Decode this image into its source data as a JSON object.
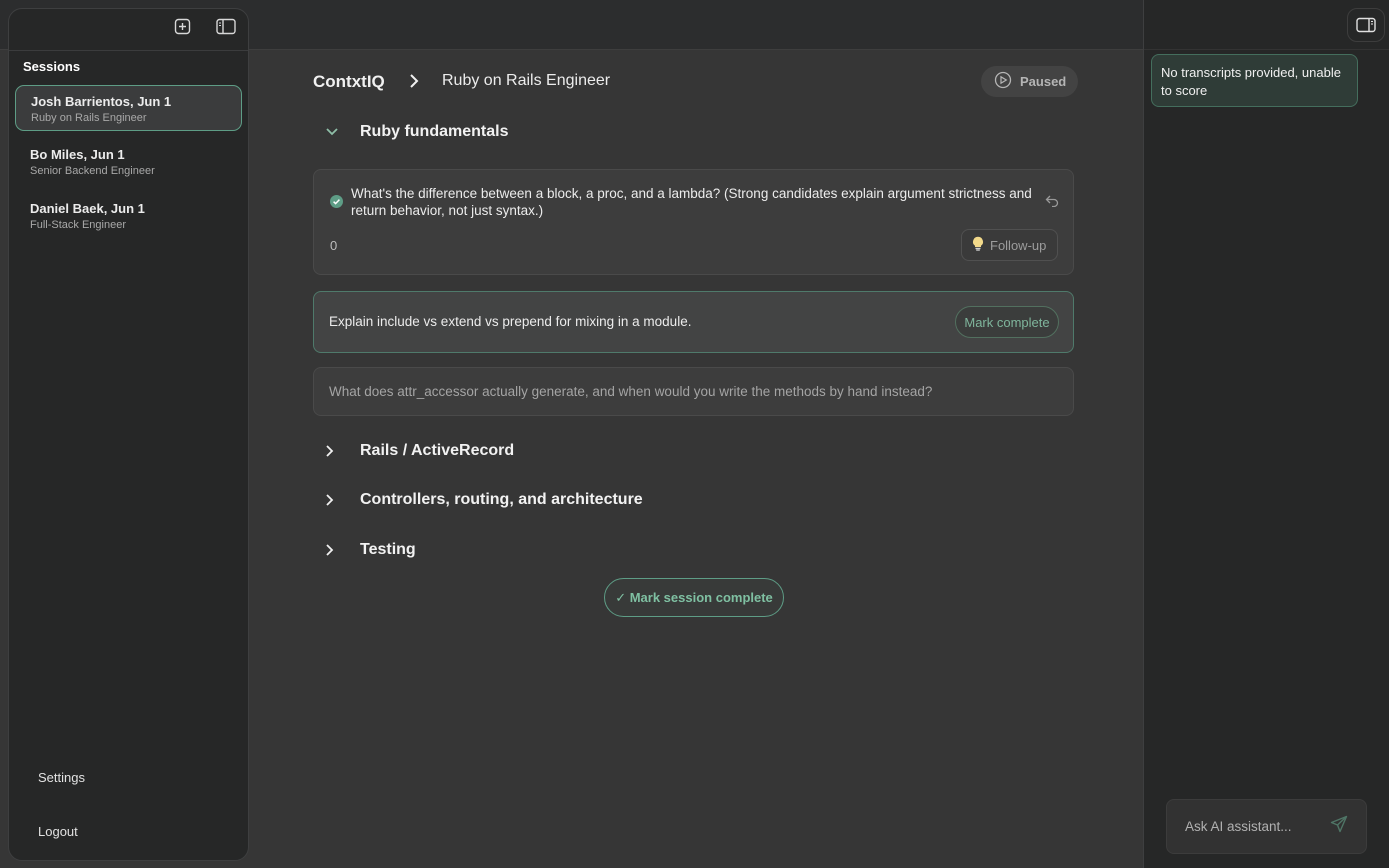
{
  "sidebar": {
    "title": "Sessions",
    "sessions": [
      {
        "name": "Josh Barrientos, Jun 1",
        "role": "Ruby on Rails Engineer",
        "active": true
      },
      {
        "name": "Bo Miles, Jun 1",
        "role": "Senior Backend Engineer",
        "active": false
      },
      {
        "name": "Daniel Baek, Jun 1",
        "role": "Full-Stack Engineer",
        "active": false
      }
    ],
    "settings_label": "Settings",
    "logout_label": "Logout"
  },
  "header": {
    "brand": "ContxtIQ",
    "page_title": "Ruby on Rails Engineer",
    "status_label": "Paused"
  },
  "sections": [
    {
      "label": "Ruby fundamentals",
      "expanded": true
    },
    {
      "label": "Rails / ActiveRecord",
      "expanded": false
    },
    {
      "label": "Controllers, routing, and architecture",
      "expanded": false
    },
    {
      "label": "Testing",
      "expanded": false
    }
  ],
  "questions": [
    {
      "text": "What's the difference between a block, a proc, and a lambda? (Strong candidates explain argument strictness and return behavior, not just syntax.)",
      "score": "0",
      "followup_label": "Follow-up",
      "status": "complete"
    },
    {
      "text": "Explain include vs extend vs prepend for mixing in a module.",
      "action_label": "Mark complete",
      "status": "current"
    },
    {
      "text": "What does attr_accessor actually generate, and when would you write the methods by hand instead?",
      "status": "pending"
    }
  ],
  "mark_session_complete_label": "✓ Mark session complete",
  "assistant": {
    "message": "No transcripts provided, unable to score",
    "input_placeholder": "Ask AI assistant..."
  },
  "colors": {
    "accent_green": "#5e9d86",
    "background": "#363636",
    "panel": "#262727"
  }
}
